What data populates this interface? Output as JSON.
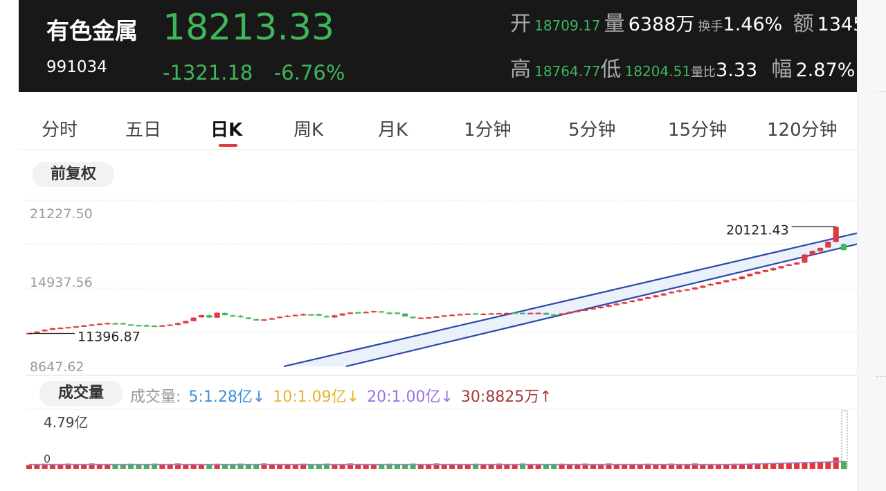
{
  "header": {
    "name": "有色金属",
    "code": "991034",
    "price": "18213.33",
    "change": "-1321.18",
    "change_pct": "-6.76%",
    "stats": {
      "open_label": "开",
      "open": "18709.17",
      "vol_label": "量",
      "vol": "6388万",
      "turnover_label": "换手",
      "turnover": "1.46%",
      "amount_label": "额",
      "amount": "1345",
      "high_label": "高",
      "high": "18764.77",
      "low_label": "低",
      "low": "18204.51",
      "ratio_label": "量比",
      "ratio": "3.33",
      "amp_label": "幅",
      "amp": "2.87%"
    }
  },
  "tabs": [
    {
      "label": "分时"
    },
    {
      "label": "五日"
    },
    {
      "label": "日K"
    },
    {
      "label": "周K"
    },
    {
      "label": "月K"
    },
    {
      "label": "1分钟"
    },
    {
      "label": "5分钟"
    },
    {
      "label": "15分钟"
    },
    {
      "label": "120分钟"
    }
  ],
  "active_tab": "日K",
  "adjust_label": "前复权",
  "volume_label": "成交量",
  "volume_legend": {
    "prefix": "成交量:",
    "ma5": "5:1.28亿↓",
    "ma10": "10:1.09亿↓",
    "ma20": "20:1.00亿↓",
    "ma30": "30:8825万↑"
  },
  "colors": {
    "up": "#e0393e",
    "down": "#3fb65a",
    "channel": "#2c4aa8",
    "ma5": "#3e8ee0",
    "ma10": "#e6b430",
    "ma20": "#9b6fe0",
    "ma30": "#a33a3a"
  },
  "chart_data": {
    "type": "candlestick",
    "y_axis_labels": [
      "21227.50",
      "14937.56",
      "8647.62"
    ],
    "ylim": [
      8647.62,
      21227.5
    ],
    "max_label": "20121.43",
    "min_label": "11396.87",
    "max_value": 20121.43,
    "min_value": 11396.87,
    "closes": [
      11440,
      11550,
      11700,
      11820,
      11870,
      11920,
      11980,
      12050,
      12130,
      12200,
      12250,
      12220,
      12150,
      12100,
      12080,
      12050,
      12030,
      12060,
      12120,
      12240,
      12420,
      12690,
      12900,
      12700,
      13090,
      12900,
      12810,
      12720,
      12580,
      12500,
      12550,
      12640,
      12770,
      12850,
      12920,
      12980,
      12960,
      12850,
      12720,
      12880,
      13030,
      13110,
      13130,
      13160,
      13230,
      13120,
      13080,
      13040,
      12780,
      12650,
      12690,
      12720,
      12790,
      12880,
      12930,
      12980,
      13020,
      13010,
      13010,
      13040,
      13060,
      13080,
      13100,
      13080,
      13080,
      13090,
      12930,
      12910,
      13040,
      13160,
      13270,
      13360,
      13470,
      13590,
      13720,
      13840,
      13960,
      14090,
      14240,
      14370,
      14520,
      14660,
      14810,
      14920,
      15010,
      15150,
      15300,
      15450,
      15610,
      15750,
      15860,
      16050,
      16270,
      16440,
      16580,
      16740,
      16900,
      17050,
      17200,
      17850,
      18150,
      18400,
      18900,
      20121.43,
      18213.33
    ],
    "volume_axis_labels": [
      "4.79亿",
      "0"
    ],
    "volume_max": 479000000,
    "last_volume": 63880000
  }
}
